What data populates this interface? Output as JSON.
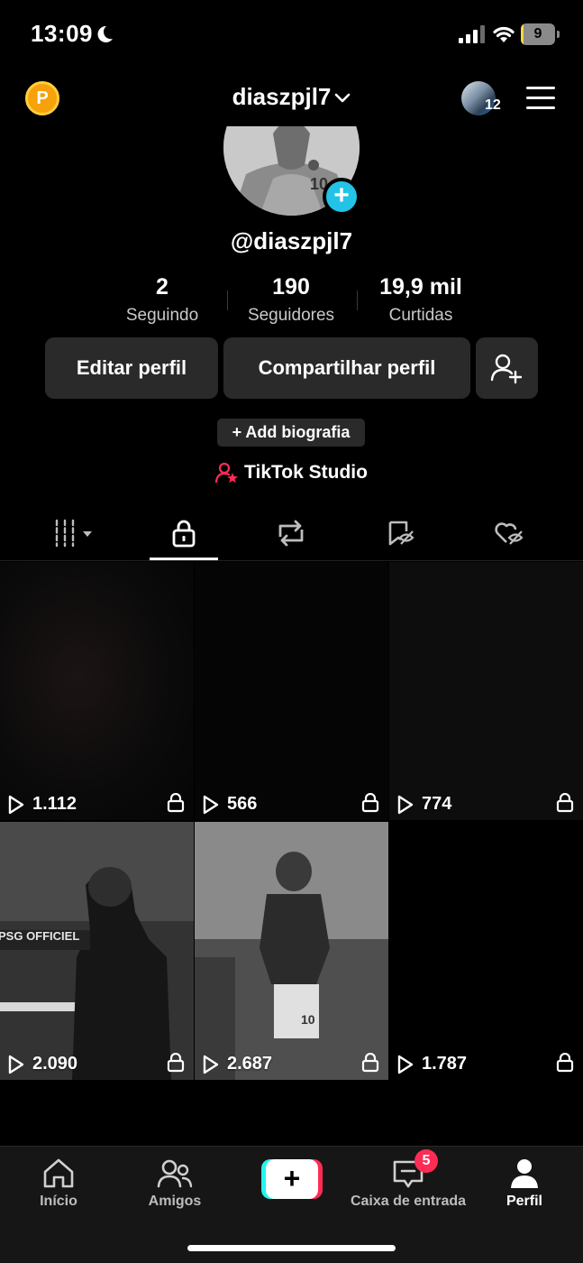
{
  "status_bar": {
    "time": "13:09",
    "battery_level": "9",
    "battery_fraction": 0.09
  },
  "header": {
    "coin_label": "P",
    "username": "diaszpjl7",
    "friends_count": "12"
  },
  "profile": {
    "handle": "@diaszpjl7",
    "stats": [
      {
        "value": "2",
        "label": "Seguindo"
      },
      {
        "value": "190",
        "label": "Seguidores"
      },
      {
        "value": "19,9 mil",
        "label": "Curtidas"
      }
    ],
    "edit_label": "Editar perfil",
    "share_label": "Compartilhar perfil",
    "bio_label": "+ Add biografia",
    "studio_label": "TikTok Studio"
  },
  "tabs": [
    {
      "name": "videos",
      "icon": "grid-icon"
    },
    {
      "name": "private",
      "icon": "lock-icon",
      "active": true
    },
    {
      "name": "reposts",
      "icon": "repost-icon"
    },
    {
      "name": "favorites",
      "icon": "hidden-bookmark-icon"
    },
    {
      "name": "liked",
      "icon": "hidden-heart-icon"
    }
  ],
  "videos": [
    {
      "views": "1.112",
      "private": true
    },
    {
      "views": "566",
      "private": true
    },
    {
      "views": "774",
      "private": true
    },
    {
      "views": "2.090",
      "private": true,
      "caption_overlay": "PSG OFFICIEL"
    },
    {
      "views": "2.687",
      "private": true
    },
    {
      "views": "1.787",
      "private": true
    }
  ],
  "bottom_nav": [
    {
      "label": "Início",
      "icon": "home-icon"
    },
    {
      "label": "Amigos",
      "icon": "friends-icon"
    },
    {
      "label": "",
      "icon": "create-plus-icon"
    },
    {
      "label": "Caixa de entrada",
      "icon": "inbox-icon",
      "badge": "5"
    },
    {
      "label": "Perfil",
      "icon": "profile-icon",
      "active": true
    }
  ],
  "colors": {
    "accent_cyan": "#25f4ee",
    "accent_red": "#fe2c55",
    "button_bg": "#2a2a2a",
    "add_badge": "#22c3e6"
  }
}
